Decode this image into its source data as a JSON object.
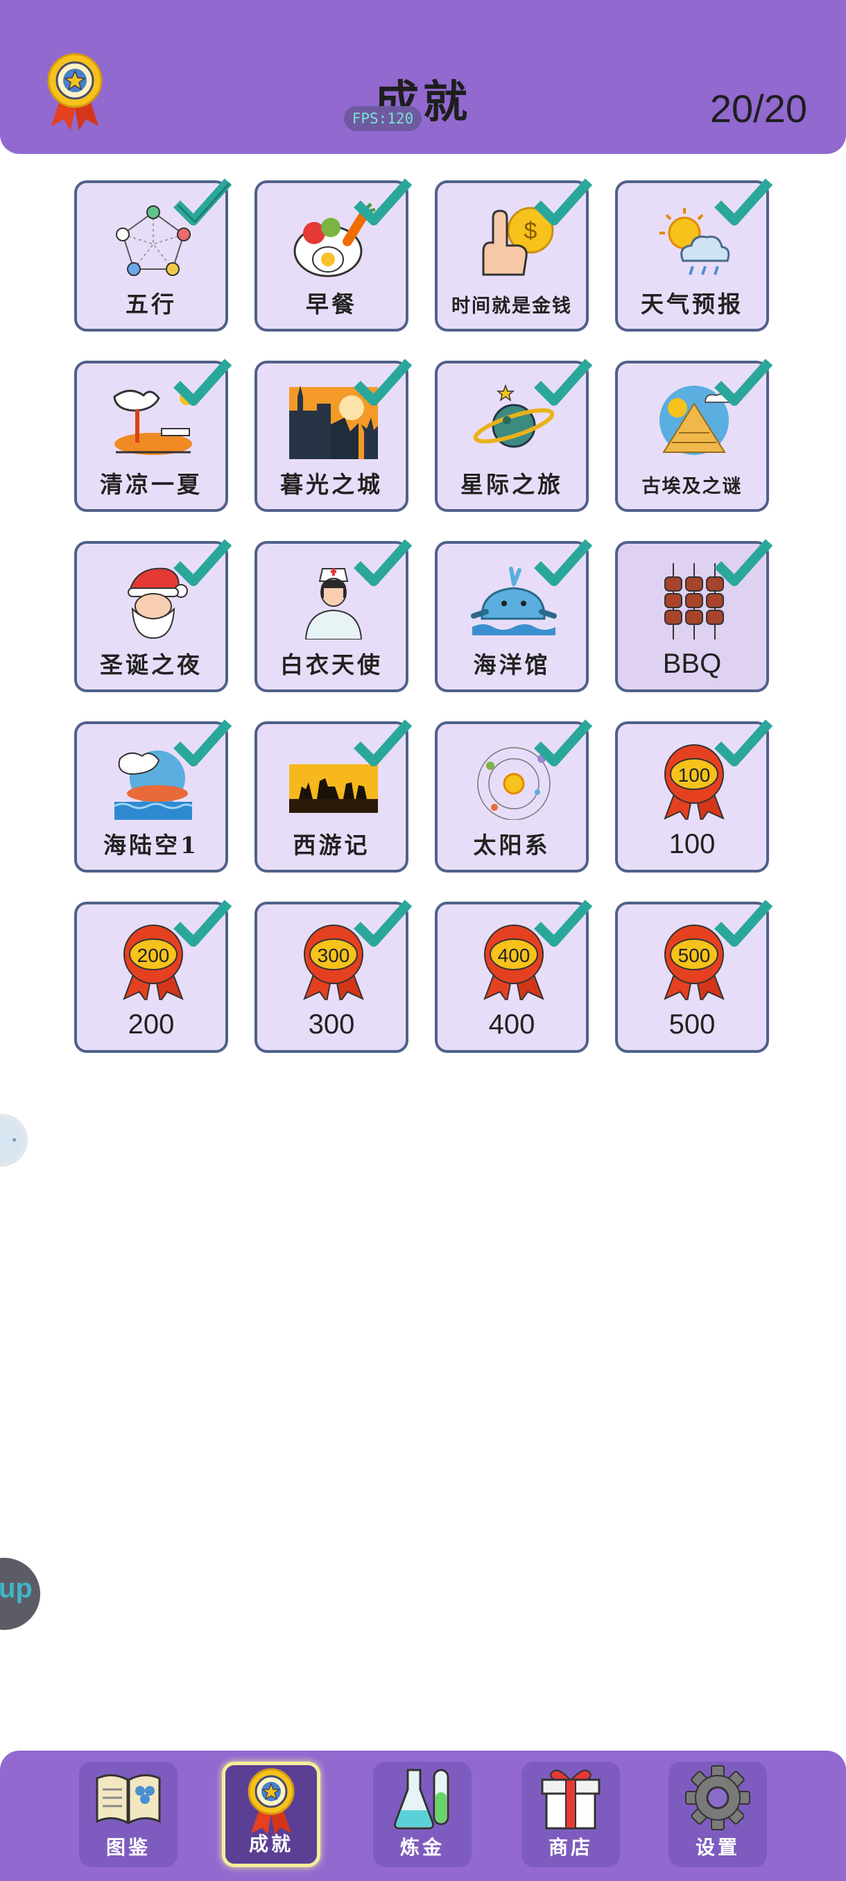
{
  "header": {
    "title": "成就",
    "fps": "FPS:120",
    "progress": "20/20",
    "icon": "medal-icon"
  },
  "achievements": [
    {
      "label": "五行",
      "icon": "five-elements-icon",
      "completed": true
    },
    {
      "label": "早餐",
      "icon": "breakfast-icon",
      "completed": true
    },
    {
      "label": "时间就是金钱",
      "icon": "time-is-money-icon",
      "completed": true
    },
    {
      "label": "天气预报",
      "icon": "weather-forecast-icon",
      "completed": true
    },
    {
      "label": "清凉一夏",
      "icon": "cool-summer-icon",
      "completed": true
    },
    {
      "label": "暮光之城",
      "icon": "twilight-city-icon",
      "completed": true
    },
    {
      "label": "星际之旅",
      "icon": "space-journey-icon",
      "completed": true
    },
    {
      "label": "古埃及之谜",
      "icon": "ancient-egypt-icon",
      "completed": true
    },
    {
      "label": "圣诞之夜",
      "icon": "santa-icon",
      "completed": true
    },
    {
      "label": "白衣天使",
      "icon": "nurse-icon",
      "completed": true
    },
    {
      "label": "海洋馆",
      "icon": "aquarium-whale-icon",
      "completed": true
    },
    {
      "label": "BBQ",
      "icon": "bbq-skewers-icon",
      "completed": true
    },
    {
      "label": "海陆空1",
      "icon": "sea-land-air-icon",
      "completed": true
    },
    {
      "label": "西游记",
      "icon": "journey-west-icon",
      "completed": true
    },
    {
      "label": "太阳系",
      "icon": "solar-system-icon",
      "completed": true
    },
    {
      "label": "100",
      "icon": "ribbon-100-icon",
      "badge": "100",
      "completed": true
    },
    {
      "label": "200",
      "icon": "ribbon-200-icon",
      "badge": "200",
      "completed": true
    },
    {
      "label": "300",
      "icon": "ribbon-300-icon",
      "badge": "300",
      "completed": true
    },
    {
      "label": "400",
      "icon": "ribbon-400-icon",
      "badge": "400",
      "completed": true
    },
    {
      "label": "500",
      "icon": "ribbon-500-icon",
      "badge": "500",
      "completed": true
    }
  ],
  "side": {
    "fab_text": "up"
  },
  "nav": {
    "items": [
      {
        "label": "图鉴",
        "icon": "book-icon",
        "active": false
      },
      {
        "label": "成就",
        "icon": "medal-icon",
        "active": true
      },
      {
        "label": "炼金",
        "icon": "flask-icon",
        "active": false
      },
      {
        "label": "商店",
        "icon": "gift-icon",
        "active": false
      },
      {
        "label": "设置",
        "icon": "gear-icon",
        "active": false
      }
    ]
  },
  "colors": {
    "header_bg": "#9169cf",
    "tile_bg": "#e8ddf8",
    "tile_border": "#4f6189",
    "check": "#2aa79b",
    "ribbon": "#e5401f",
    "gold": "#f6c21b"
  }
}
